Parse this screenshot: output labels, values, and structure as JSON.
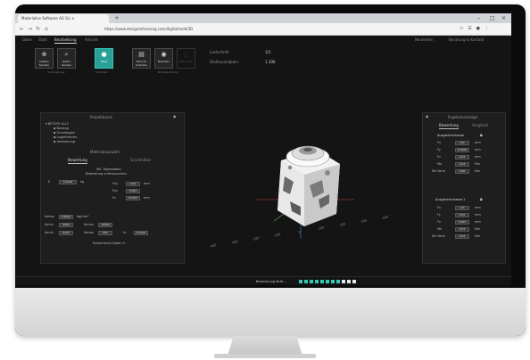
{
  "browser": {
    "tab_title": "Materialise Software AG Sci ×",
    "url": "https://www.designtofreezing.com/digitalmold/3D",
    "new_tab": "+"
  },
  "menu": [
    "Datei",
    "Start",
    "Bearbeitung",
    "Ansicht"
  ],
  "menu_active_index": 2,
  "top_right": [
    "Neuheiten",
    "Beratung & Kontakt"
  ],
  "ribbon": {
    "buttons": [
      {
        "label": "Details Senden",
        "icon": "zoom-in-icon"
      },
      {
        "label": "Daten Senden",
        "icon": "search-icon"
      },
      {
        "label": "Start",
        "icon": "play-icon"
      },
      {
        "label": "Bericht Aufrufen",
        "icon": "document-icon"
      },
      {
        "label": "Beenden",
        "icon": "stop-icon"
      },
      {
        "label": "Abbrechen",
        "icon": "spinner-icon"
      }
    ],
    "groups": [
      "Vorbereitung",
      "Kontrolle",
      "Nachbereitung"
    ]
  },
  "info": {
    "items": [
      {
        "label": "Lastschritt:",
        "value": "1/1"
      },
      {
        "label": "Stufenvariablen:",
        "value": "1.100"
      }
    ]
  },
  "left_panel": {
    "title": "Projektbaum",
    "tree_root": "BETSYS ALL2",
    "tree_children": [
      "Nutzlug",
      "Grundlagen",
      "Lagerformen",
      "Verformung"
    ],
    "section_title": "Materialauswahl",
    "subtabs": [
      "Bewertung",
      "Grundsätze"
    ],
    "sub_header": [
      "Wk. Tagesdaten",
      "Bewertung unterspannten"
    ],
    "row1": {
      "label": "E",
      "value": "2.41e5",
      "unit": "kg"
    },
    "props": [
      {
        "label": "Fxy",
        "value": "0.01",
        "unit": "mm"
      },
      {
        "label": "Fyz",
        "value": "0.001",
        "unit": ""
      },
      {
        "label": "Fz",
        "value": "10.001",
        "unit": "mm"
      }
    ],
    "bottom_fields": [
      {
        "label": "fzmax",
        "value": "0.0025",
        "unit": "kg/mm²"
      },
      {
        "label": "fymin",
        "value": "0000",
        "label2": "fymax",
        "value2": "10000"
      },
      {
        "label": "fxmin",
        "value": "0x01",
        "label2": "fxmax",
        "value2": "001",
        "label3": "fz",
        "value3": "4.01e2"
      }
    ],
    "footer": "Numerische Daten"
  },
  "right_panel": {
    "title": "Ergebnisanzeige",
    "subtabs": [
      "Bewertung",
      "Vergleich"
    ],
    "section1": "Ausgleichsmasse",
    "rows1": [
      {
        "label": "Fx",
        "value": "0.0",
        "unit": "mm"
      },
      {
        "label": "Fy",
        "value": "0.0100",
        "unit": "mm"
      },
      {
        "label": "Fz",
        "value": "0.01",
        "unit": "mm"
      },
      {
        "label": "Mx",
        "value": "0.01",
        "unit": "Nm"
      },
      {
        "label": "Mz Vorm",
        "value": "0.00",
        "unit": "Nm"
      }
    ],
    "section2": "Ausgleichsmasse 2",
    "rows2": [
      {
        "label": "Fx",
        "value": "0.0",
        "unit": "mm"
      },
      {
        "label": "Fy",
        "value": "0.01",
        "unit": "mm"
      },
      {
        "label": "Fz",
        "value": "0.001",
        "unit": "mm"
      },
      {
        "label": "Mx",
        "value": "0.01",
        "unit": "Nm"
      },
      {
        "label": "Mz Vorm",
        "value": "0.01",
        "unit": "Nm"
      }
    ]
  },
  "viewport": {
    "axis_ticks": [
      "-400",
      "-300",
      "-200",
      "-100",
      "0",
      "100",
      "200",
      "300",
      "400"
    ]
  },
  "status": {
    "label": "Berechnung läuft ...",
    "segments_total": 11,
    "segments_filled": 8
  },
  "colors": {
    "accent": "#2aa196",
    "progress": "#33c9b0"
  }
}
